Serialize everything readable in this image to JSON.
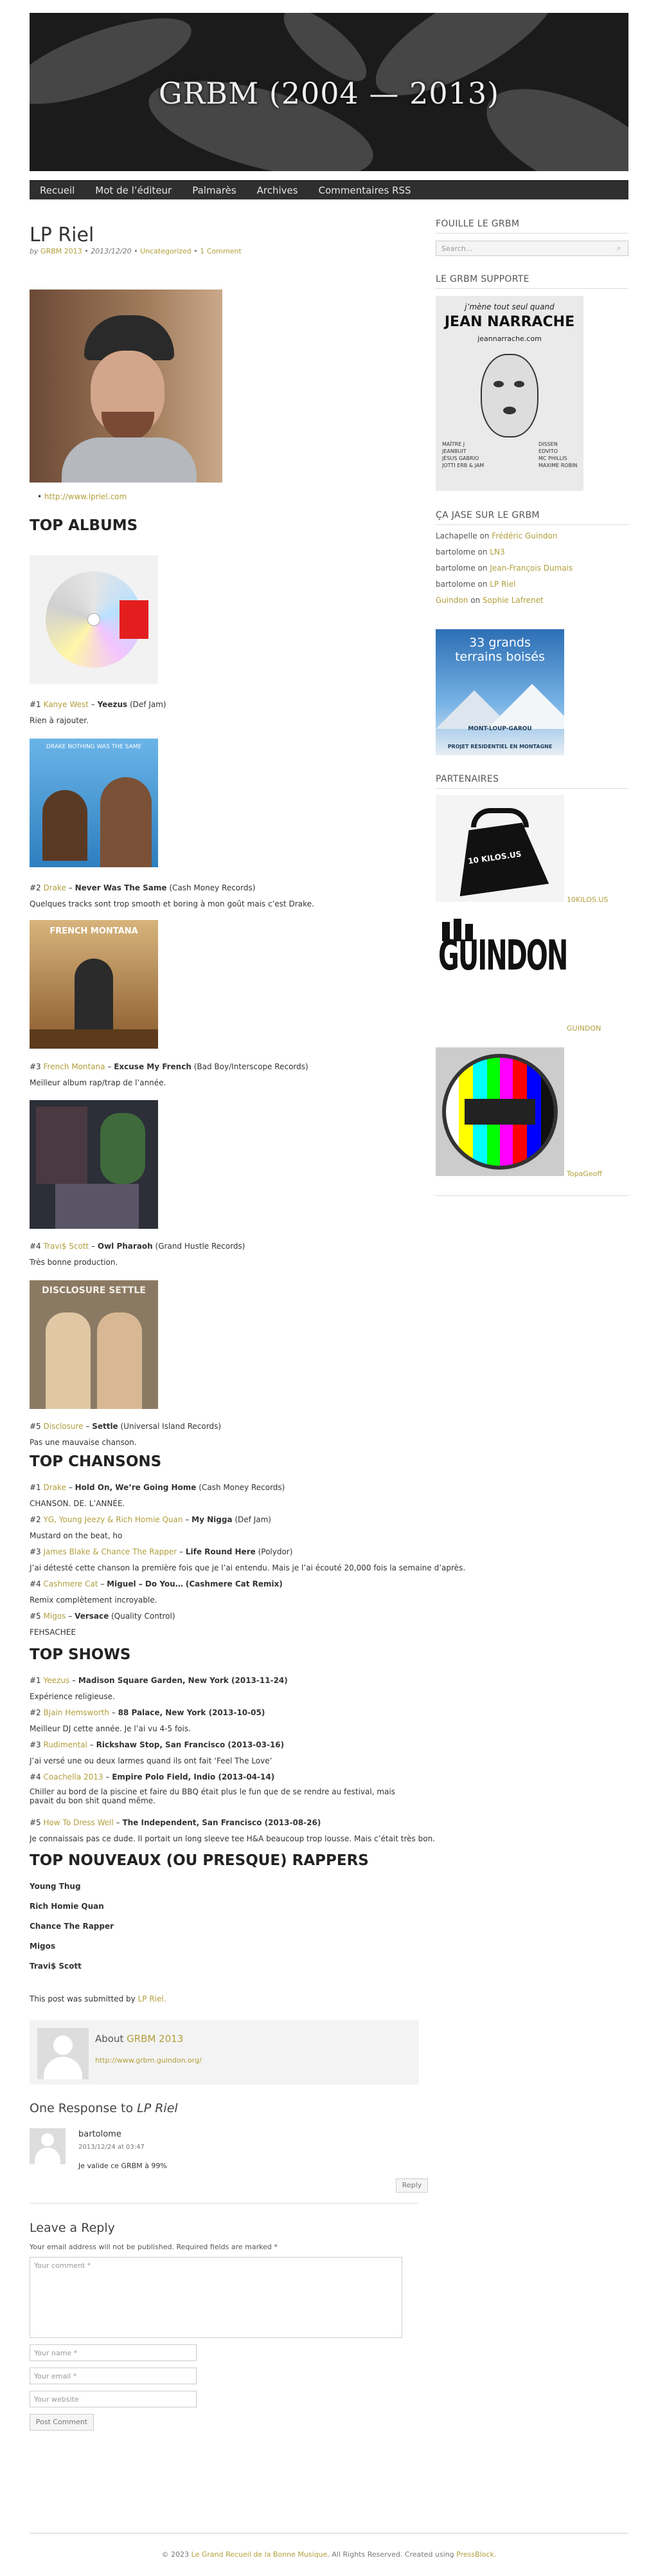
{
  "site": {
    "banner_title": "GRBM (2004 — 2013)"
  },
  "nav": [
    "Recueil",
    "Mot de l’éditeur",
    "Palmarès",
    "Archives",
    "Commentaires RSS"
  ],
  "post": {
    "title": "LP Riel",
    "meta_by": "by",
    "author": "GRBM 2013",
    "date": "2013/12/20",
    "category": "Uncategorized",
    "comments_link": "1 Comment",
    "link": "http://www.lpriel.com"
  },
  "sections": {
    "top_albums": "TOP ALBUMS",
    "top_chansons": "TOP CHANSONS",
    "top_shows": "TOP SHOWS",
    "top_nouveaux": "TOP NOUVEAUX (OU PRESQUE) RAPPERS"
  },
  "albums": [
    {
      "rank": "#1",
      "artist": "Kanye West",
      "title": "Yeezus",
      "label": "(Def Jam)",
      "comment": "Rien à rajouter."
    },
    {
      "rank": "#2",
      "artist": "Drake",
      "title": "Never Was The Same",
      "label": "(Cash Money Records)",
      "comment": "Quelques tracks sont trop smooth et boring à mon goût mais c’est Drake."
    },
    {
      "rank": "#3",
      "artist": "French Montana",
      "title": "Excuse My French",
      "label": "(Bad Boy/Interscope Records)",
      "comment": "Meilleur album rap/trap de l’année."
    },
    {
      "rank": "#4",
      "artist": "Travi$ Scott",
      "title": "Owl Pharaoh",
      "label": "(Grand Hustle Records)",
      "comment": "Très bonne production."
    },
    {
      "rank": "#5",
      "artist": "Disclosure",
      "title": "Settle",
      "label": "(Universal Island Records)",
      "comment": "Pas une mauvaise chanson."
    }
  ],
  "covers": {
    "c2_text": "DRAKE  NOTHING WAS THE SAME",
    "c3_text": "FRENCH MONTANA",
    "c5_text": "DISCLOSURE SETTLE"
  },
  "chansons": [
    {
      "rank": "#1",
      "artist": "Drake",
      "title": "Hold On, We’re Going Home",
      "label": "(Cash Money Records)",
      "comment": "CHANSON. DE. L’ANNÉE."
    },
    {
      "rank": "#2",
      "artist": "YG, Young Jeezy & Rich Homie Quan",
      "title": "My Nigga",
      "label": "(Def Jam)",
      "comment": "Mustard on the beat, ho"
    },
    {
      "rank": "#3",
      "artist": "James Blake & Chance The Rapper",
      "title": "Life Round Here",
      "label": "(Polydor)",
      "comment": "J’ai détesté cette chanson la première fois que je l’ai entendu. Mais je l’ai écouté 20,000 fois la semaine d’après."
    },
    {
      "rank": "#4",
      "artist": "Cashmere Cat",
      "title": "Miguel – Do You… (Cashmere Cat Remix)",
      "label": "",
      "comment": "Remix complètement incroyable."
    },
    {
      "rank": "#5",
      "artist": "Migos",
      "title": "Versace",
      "label": "(Quality Control)",
      "comment": "FEHSACHEE"
    }
  ],
  "shows": [
    {
      "rank": "#1",
      "artist": "Yeezus",
      "title": "Madison Square Garden, New York (2013-11-24)",
      "comment": "Expérience religieuse."
    },
    {
      "rank": "#2",
      "artist": "Bjain Hemsworth",
      "title": "88 Palace, New York (2013-10-05)",
      "comment": "Meilleur DJ cette année. Je l’ai vu 4-5 fois."
    },
    {
      "rank": "#3",
      "artist": "Rudimental",
      "title": "Rickshaw Stop, San Francisco (2013-03-16)",
      "comment": "J’ai versé une ou deux larmes quand ils ont fait ‘Feel The Love’"
    },
    {
      "rank": "#4",
      "artist": "Coachella 2013",
      "title": "Empire Polo Field, Indio (2013-04-14)",
      "comment": "Chiller au bord de la piscine et faire du BBQ était plus le fun que de se rendre au festival, mais pavait du bon shit quand même."
    },
    {
      "rank": "#5",
      "artist": "How To Dress Well",
      "title": "The Independent, San Francisco (2013-08-26)",
      "comment": "Je connaissais pas ce dude. Il portait un long sleeve tee H&A beaucoup trop lousse. Mais c’était très bon."
    }
  ],
  "rappers": [
    "Young Thug",
    "Rich Homie Quan",
    "Chance The Rapper",
    "Migos",
    "Travi$ Scott"
  ],
  "submitted": {
    "text": "This post was submitted by",
    "by": "LP Riel."
  },
  "about": {
    "label": "About",
    "name": "GRBM 2013",
    "url": "http://www.grbm.guindon.org/"
  },
  "responses": {
    "title_prefix": "One Response to",
    "title_em": "LP Riel"
  },
  "comment": {
    "author": "bartolome",
    "date": "2013/12/24 at 03:47",
    "text": "Je valide ce GRBM à 99%",
    "reply": "Reply"
  },
  "reply_form": {
    "heading": "Leave a Reply",
    "note": "Your email address will not be published. Required fields are marked *",
    "comment_ph": "Your comment *",
    "name_ph": "Your name *",
    "email_ph": "Your email *",
    "website_ph": "Your website",
    "submit": "Post Comment"
  },
  "sidebar": {
    "search_heading": "FOUILLE LE GRBM",
    "search_ph": "Search...",
    "support_heading": "LE GRBM SUPPORTE",
    "jean_lines": [
      "j’mène tout seul quand",
      "JEAN NARRACHE",
      "jeannarrache.com"
    ],
    "jean_left": "MAÎTRE J\nJEANBUIT\nJÉSUS GABRIO\nJOTTI ERB & JAM",
    "jean_right": "DISSEN\nEDVITO\nMC PHILLIS\nMAXIME ROBIN",
    "jase_heading": "ÇA JASE SUR LE GRBM",
    "recent_comments": [
      {
        "author": "Lachapelle",
        "on": "on",
        "post": "Frédéric Guindon"
      },
      {
        "author": "bartolome",
        "on": "on",
        "post": "LN3"
      },
      {
        "author": "bartolome",
        "on": "on",
        "post": "Jean-François Dumais"
      },
      {
        "author": "bartolome",
        "on": "on",
        "post": "LP Riel"
      },
      {
        "author": "Guindon",
        "on": "on",
        "post": "Sophie Lafrenet"
      }
    ],
    "ad_text": [
      "33 grands",
      "terrains boisés"
    ],
    "ad_brand": "MONT-LOUP-GAROU",
    "ad_sub": "PROJET RÉSIDENTIEL EN MONTAGNE",
    "partners_heading": "PARTENAIRES",
    "partners": [
      {
        "name": "10KILOS.US",
        "weight_text": "10 KILOS.US"
      },
      {
        "name": "GUINDON",
        "weight_text": "GUINDON"
      },
      {
        "name": "TopaGeoff",
        "weight_text": ""
      }
    ]
  },
  "footer": {
    "prefix": "© 2023",
    "site": "Le Grand Recueil de la Bonne Musique",
    "rights": ". All Rights Reserved. Created using",
    "theme": "PressBlock."
  }
}
